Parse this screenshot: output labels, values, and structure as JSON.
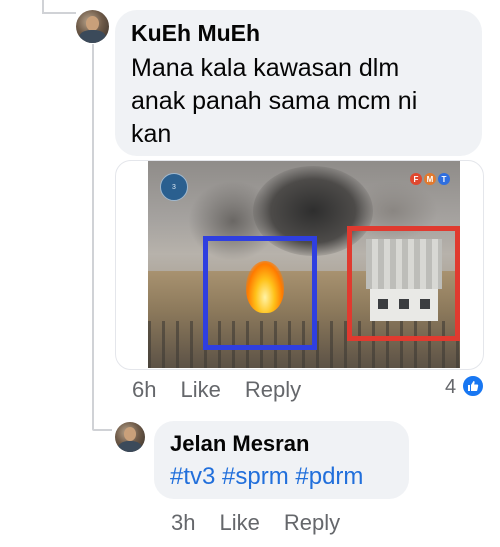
{
  "comment": {
    "author": "KuEh MuEh",
    "text_lines": [
      "Mana kala kawasan dlm",
      "anak panah sama mcm ni",
      "kan"
    ],
    "time": "6h",
    "like_label": "Like",
    "reply_label": "Reply",
    "reaction_count": "4",
    "attachment": {
      "overlay_left_logo_text": "3",
      "overlay_right_logo_letters": [
        "F",
        "M",
        "T"
      ]
    }
  },
  "reply": {
    "author": "Jelan Mesran",
    "hashtags": "#tv3 #sprm #pdrm",
    "time": "3h",
    "like_label": "Like",
    "reply_label": "Reply"
  },
  "colors": {
    "bubble_bg": "#f0f2f5",
    "meta_text": "#65676b",
    "hashtag_blue": "#216fdb",
    "like_blue": "#1877f2",
    "box_blue": "#2f3fe0",
    "box_red": "#e03a2f"
  },
  "icons": [
    "thumbs-up-icon"
  ]
}
